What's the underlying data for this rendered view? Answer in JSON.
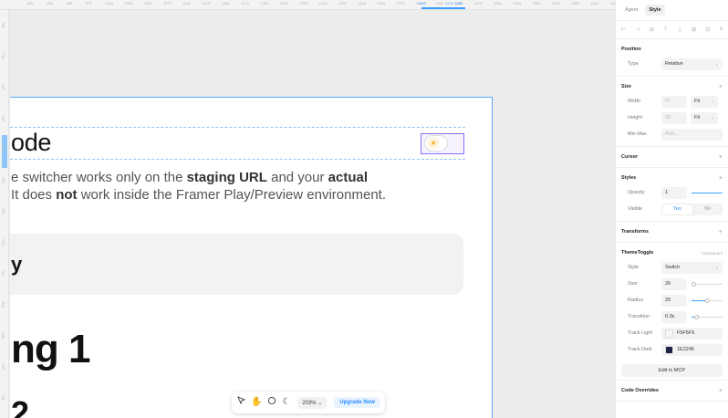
{
  "ruler": {
    "top_ticks": [
      "850",
      "900",
      "950",
      "975",
      "1000",
      "1025",
      "1050",
      "1075",
      "1100",
      "1125",
      "1150",
      "1175",
      "1200",
      "1225",
      "1250",
      "1275",
      "1300",
      "1325",
      "1350",
      "1375",
      "1400",
      "1425",
      "1450",
      "1475",
      "1500",
      "1525",
      "1550",
      "1575",
      "1600",
      "1625",
      "1650"
    ],
    "highlight_ticks": [
      "1245",
      "1275 1280"
    ],
    "left_ticks": [
      "400",
      "450",
      "500",
      "550",
      "600",
      "625",
      "650",
      "700",
      "750",
      "800",
      "850",
      "900",
      "950"
    ]
  },
  "canvas": {
    "heading_mode": "ode",
    "para_line1_pre": "e switcher works only on the ",
    "para_line1_bold1": "staging URL",
    "para_line1_mid": " and your ",
    "para_line1_bold2": "actual",
    "para_line2_pre": " It does ",
    "para_line2_bold": "not",
    "para_line2_post": " work inside the Framer Play/Preview environment.",
    "callout_text": "y",
    "heading_1": "ng 1",
    "heading_2": "2",
    "toggle_icon": "sun-icon"
  },
  "toolbar": {
    "zoom": "203%",
    "zoom_chevron": "⌄",
    "upgrade_label": "Upgrade Now",
    "icons": [
      "cursor-icon",
      "hand-icon",
      "comment-icon",
      "moon-icon"
    ]
  },
  "panel": {
    "tabs": [
      "Agent",
      "Style"
    ],
    "active_tab": "Style",
    "align_icons": [
      "⊢",
      "⊣",
      "⊟",
      "⊤",
      "⊥",
      "⊞",
      "⊡",
      "≡"
    ],
    "position": {
      "title": "Position",
      "type_label": "Type",
      "type_value": "Relative"
    },
    "size": {
      "title": "Size",
      "width_label": "Width",
      "width_value": "47",
      "width_mode": "Fit",
      "height_label": "Height",
      "height_value": "26",
      "height_mode": "Fit",
      "minmax_label": "Min Max",
      "minmax_value": "Add..."
    },
    "cursor": {
      "title": "Cursor"
    },
    "styles": {
      "title": "Styles",
      "opacity_label": "Opacity",
      "opacity_value": "1",
      "visible_label": "Visible",
      "visible_yes": "Yes",
      "visible_no": "No"
    },
    "transforms": {
      "title": "Transforms"
    },
    "theme_toggle": {
      "title": "ThemeToggle",
      "note": "Component",
      "style_label": "Style",
      "style_value": "Switch",
      "size_label": "Size",
      "size_value": "26",
      "size_level": 0.05,
      "radius_label": "Radius",
      "radius_value": "20",
      "radius_level": 0.5,
      "transition_label": "Transition",
      "transition_value": "0.3s",
      "transition_level": 0.15,
      "track_light_label": "Track Light",
      "track_light_value": "F5F5F5",
      "track_light_color": "#F5F5F5",
      "track_dark_label": "Track Dark",
      "track_dark_value": "1E2245",
      "track_dark_color": "#1E2245",
      "edit_label": "Edit in MCP"
    },
    "code_overrides": {
      "title": "Code Overrides"
    }
  },
  "colors": {
    "accent": "#2b8cff",
    "selection": "#55aaff",
    "component": "#8a6dff"
  }
}
